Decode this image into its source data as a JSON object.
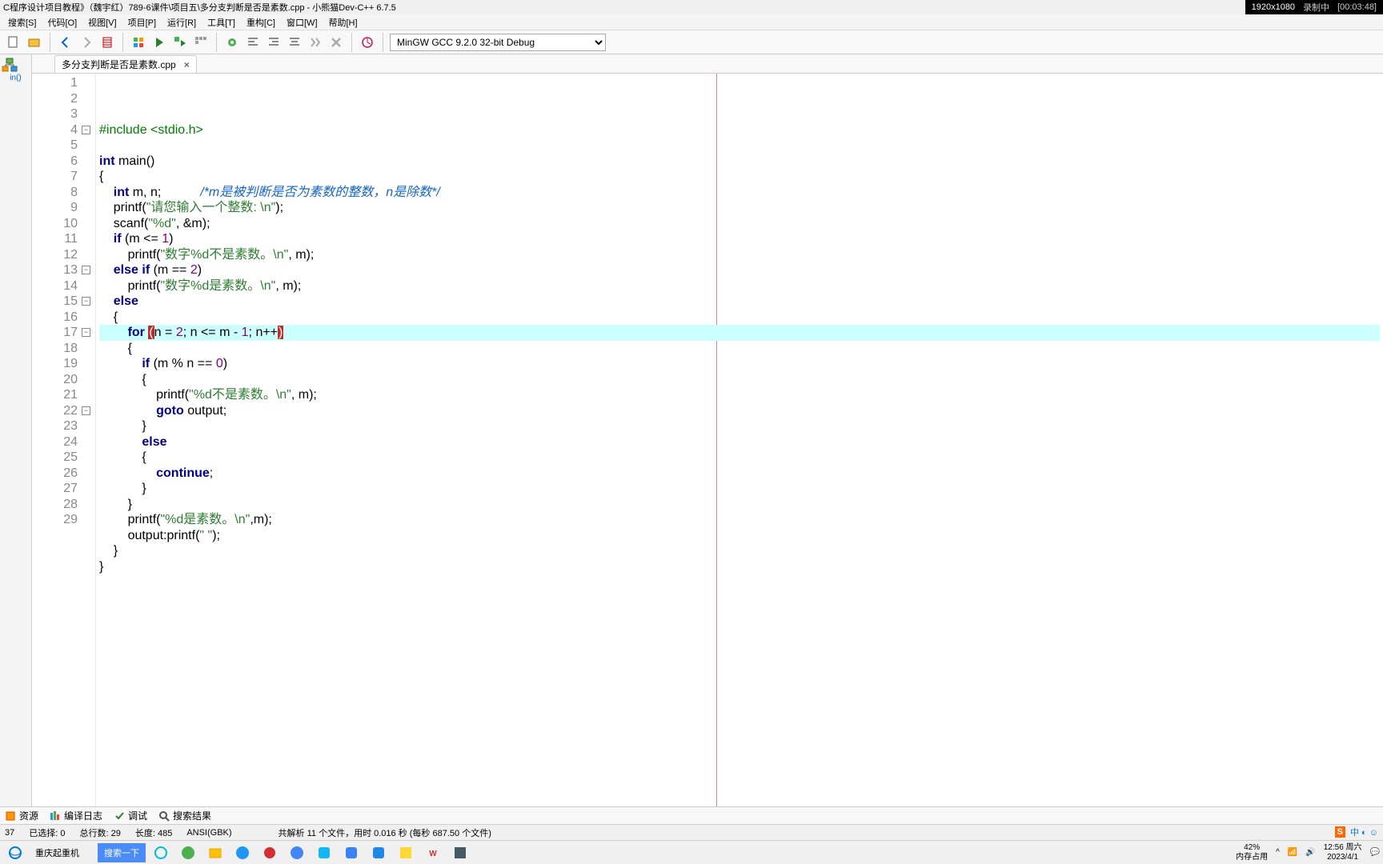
{
  "title": "C程序设计项目教程》（魏宇红）789-6课件\\项目五\\多分支判断是否是素数.cpp - 小熊猫Dev-C++ 6.7.5",
  "recorder": {
    "dim": "1920x1080",
    "status": "录制中",
    "time": "[00:03:48]"
  },
  "menus": [
    "搜索[S]",
    "代码[O]",
    "视图[V]",
    "项目[P]",
    "运行[R]",
    "工具[T]",
    "重构[C]",
    "窗口[W]",
    "帮助[H]"
  ],
  "compiler": "MinGW GCC 9.2.0 32-bit Debug",
  "left_panel_lbl": "in()",
  "tab": {
    "name": "多分支判断是否是素数.cpp"
  },
  "code": {
    "lines": [
      {
        "n": 1,
        "tokens": [
          [
            "pre",
            "#include <stdio.h>"
          ]
        ]
      },
      {
        "n": 2,
        "tokens": []
      },
      {
        "n": 3,
        "tokens": [
          [
            "kw",
            "int "
          ],
          [
            "fn",
            "main"
          ],
          [
            "op",
            "()"
          ]
        ]
      },
      {
        "n": 4,
        "fold": true,
        "tokens": [
          [
            "op",
            "{"
          ]
        ]
      },
      {
        "n": 5,
        "tokens": [
          [
            "pad",
            "    "
          ],
          [
            "kw",
            "int "
          ],
          [
            "id",
            "m, n;"
          ],
          [
            "pad",
            "           "
          ],
          [
            "cmt",
            "/*m是被判断是否为素数的整数，n是除数*/"
          ]
        ]
      },
      {
        "n": 6,
        "tokens": [
          [
            "pad",
            "    "
          ],
          [
            "fn",
            "printf"
          ],
          [
            "op",
            "("
          ],
          [
            "str",
            "\"请您输入一个整数: \\n\""
          ],
          [
            "op",
            ");"
          ]
        ]
      },
      {
        "n": 7,
        "tokens": [
          [
            "pad",
            "    "
          ],
          [
            "fn",
            "scanf"
          ],
          [
            "op",
            "("
          ],
          [
            "str",
            "\"%d\""
          ],
          [
            "op",
            ", &m);"
          ]
        ]
      },
      {
        "n": 8,
        "tokens": [
          [
            "pad",
            "    "
          ],
          [
            "kw",
            "if "
          ],
          [
            "op",
            "(m <= "
          ],
          [
            "num",
            "1"
          ],
          [
            "op",
            ")"
          ]
        ]
      },
      {
        "n": 9,
        "tokens": [
          [
            "pad",
            "        "
          ],
          [
            "fn",
            "printf"
          ],
          [
            "op",
            "("
          ],
          [
            "str",
            "\"数字%d不是素数。\\n\""
          ],
          [
            "op",
            ", m);"
          ]
        ]
      },
      {
        "n": 10,
        "tokens": [
          [
            "pad",
            "    "
          ],
          [
            "kw",
            "else if "
          ],
          [
            "op",
            "(m == "
          ],
          [
            "num",
            "2"
          ],
          [
            "op",
            ")"
          ]
        ]
      },
      {
        "n": 11,
        "tokens": [
          [
            "pad",
            "        "
          ],
          [
            "fn",
            "printf"
          ],
          [
            "op",
            "("
          ],
          [
            "str",
            "\"数字%d是素数。\\n\""
          ],
          [
            "op",
            ", m);"
          ]
        ]
      },
      {
        "n": 12,
        "tokens": [
          [
            "pad",
            "    "
          ],
          [
            "kw",
            "else"
          ]
        ]
      },
      {
        "n": 13,
        "fold": true,
        "tokens": [
          [
            "pad",
            "    "
          ],
          [
            "op",
            "{"
          ]
        ]
      },
      {
        "n": 14,
        "hl": true,
        "tokens": [
          [
            "pad",
            "        "
          ],
          [
            "kw",
            "for "
          ],
          [
            "mp",
            "("
          ],
          [
            "id",
            "n = "
          ],
          [
            "num",
            "2"
          ],
          [
            "op",
            "; n <= m - "
          ],
          [
            "num",
            "1"
          ],
          [
            "op",
            "; n++"
          ],
          [
            "mp",
            ")"
          ]
        ]
      },
      {
        "n": 15,
        "fold": true,
        "tokens": [
          [
            "pad",
            "        "
          ],
          [
            "op",
            "{"
          ]
        ]
      },
      {
        "n": 16,
        "tokens": [
          [
            "pad",
            "            "
          ],
          [
            "kw",
            "if "
          ],
          [
            "op",
            "(m % n == "
          ],
          [
            "num",
            "0"
          ],
          [
            "op",
            ")"
          ]
        ]
      },
      {
        "n": 17,
        "fold": true,
        "tokens": [
          [
            "pad",
            "            "
          ],
          [
            "op",
            "{"
          ]
        ]
      },
      {
        "n": 18,
        "tokens": [
          [
            "pad",
            "                "
          ],
          [
            "fn",
            "printf"
          ],
          [
            "op",
            "("
          ],
          [
            "str",
            "\"%d不是素数。\\n\""
          ],
          [
            "op",
            ", m);"
          ]
        ]
      },
      {
        "n": 19,
        "tokens": [
          [
            "pad",
            "                "
          ],
          [
            "kw",
            "goto "
          ],
          [
            "id",
            "output;"
          ]
        ]
      },
      {
        "n": 20,
        "tokens": [
          [
            "pad",
            "            "
          ],
          [
            "op",
            "}"
          ]
        ]
      },
      {
        "n": 21,
        "tokens": [
          [
            "pad",
            "            "
          ],
          [
            "kw",
            "else"
          ]
        ]
      },
      {
        "n": 22,
        "fold": true,
        "tokens": [
          [
            "pad",
            "            "
          ],
          [
            "op",
            "{"
          ]
        ]
      },
      {
        "n": 23,
        "tokens": [
          [
            "pad",
            "                "
          ],
          [
            "kw",
            "continue"
          ],
          [
            "op",
            ";"
          ]
        ]
      },
      {
        "n": 24,
        "tokens": [
          [
            "pad",
            "            "
          ],
          [
            "op",
            "}"
          ]
        ]
      },
      {
        "n": 25,
        "tokens": [
          [
            "pad",
            "        "
          ],
          [
            "op",
            "}"
          ]
        ]
      },
      {
        "n": 26,
        "tokens": [
          [
            "pad",
            "        "
          ],
          [
            "fn",
            "printf"
          ],
          [
            "op",
            "("
          ],
          [
            "str",
            "\"%d是素数。\\n\""
          ],
          [
            "op",
            ",m);"
          ]
        ]
      },
      {
        "n": 27,
        "tokens": [
          [
            "pad",
            "        "
          ],
          [
            "id",
            "output:"
          ],
          [
            "fn",
            "printf"
          ],
          [
            "op",
            "("
          ],
          [
            "str",
            "\" \""
          ],
          [
            "op",
            ");"
          ]
        ]
      },
      {
        "n": 28,
        "tokens": [
          [
            "pad",
            "    "
          ],
          [
            "op",
            "}"
          ]
        ]
      },
      {
        "n": 29,
        "tokens": [
          [
            "op",
            "}"
          ]
        ]
      }
    ]
  },
  "bottom_tabs": [
    "资源",
    "编译日志",
    "调试",
    "搜索结果"
  ],
  "status": {
    "col": "37",
    "sel": "已选择:   0",
    "total": "总行数:   29",
    "len": "长度:   485",
    "enc": "ANSI(GBK)",
    "parse": "共解析 11 个文件，用时 0.016 秒 (每秒 687.50 个文件)"
  },
  "taskbar": {
    "search_hint": "重庆起重机",
    "cm": "搜索一下",
    "tray_pct": "42%",
    "tray_mem": "内存占用",
    "time1": "12:56 周六",
    "time2": "2023/4/1"
  }
}
